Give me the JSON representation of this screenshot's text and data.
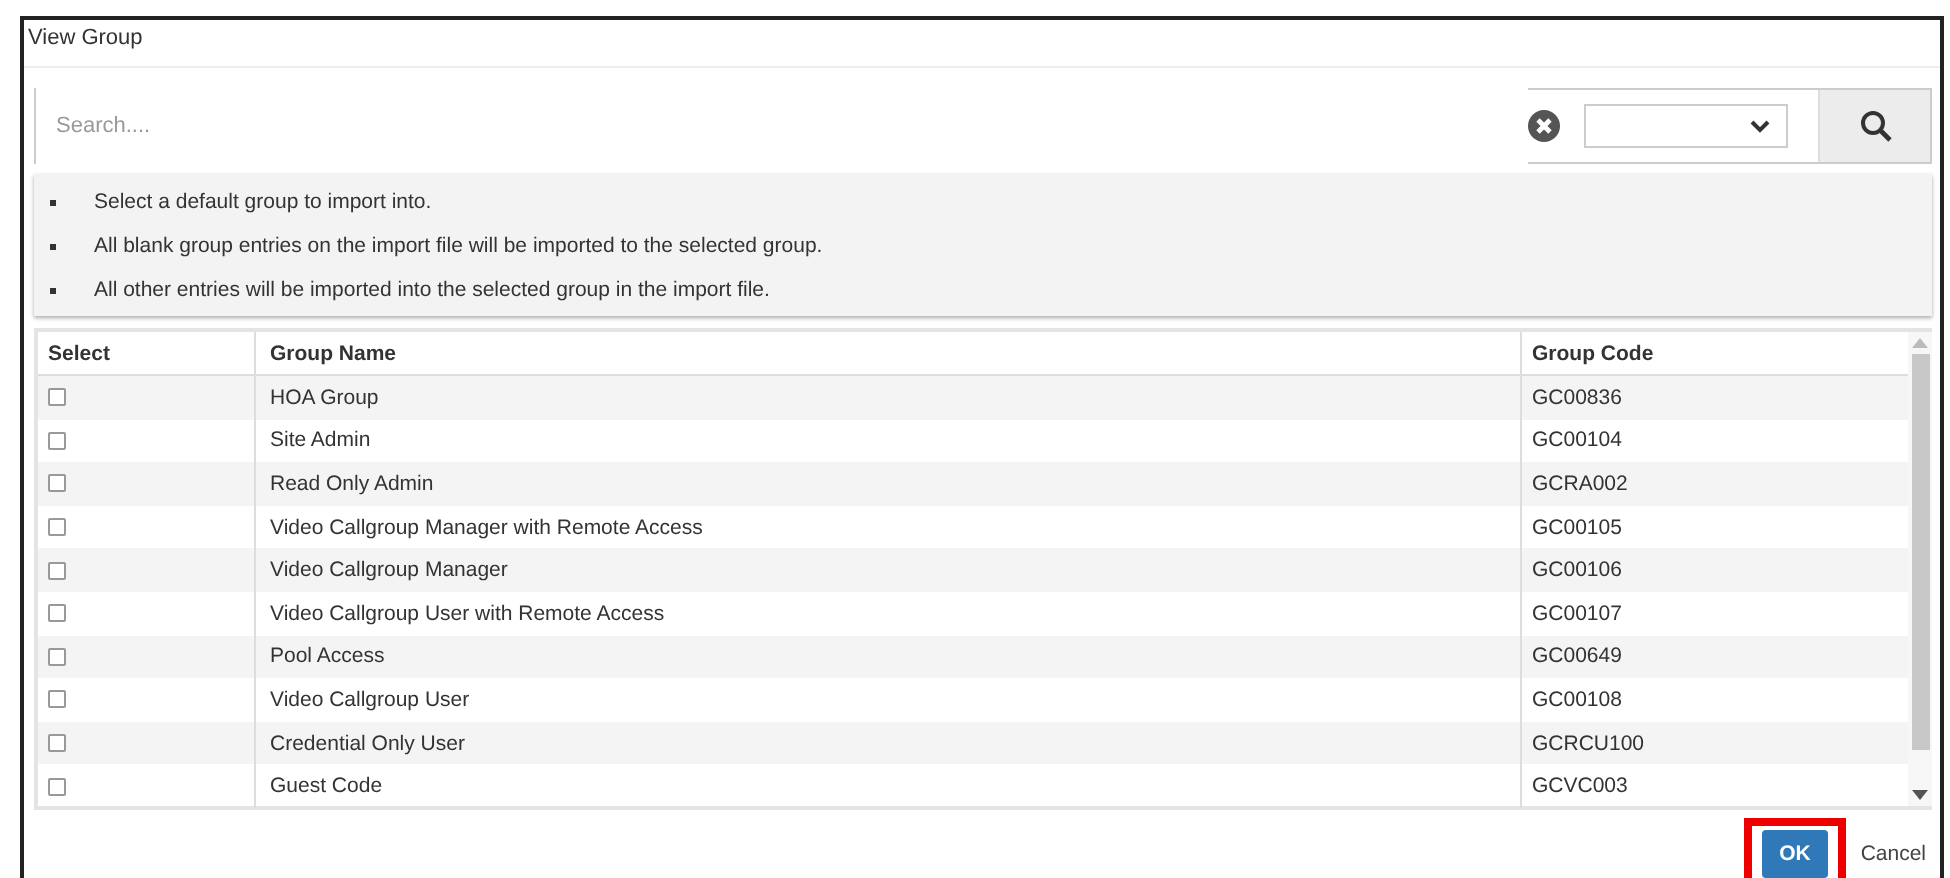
{
  "window": {
    "title": "View Group"
  },
  "search": {
    "placeholder": "Search...."
  },
  "notes": [
    "Select a default group to import into.",
    "All blank group entries on the import file will be imported to the selected group.",
    "All other entries will be imported into the selected group in the import file."
  ],
  "table": {
    "columns": [
      "Select",
      "Group Name",
      "Group Code"
    ],
    "rows": [
      {
        "checked": false,
        "name": "HOA Group",
        "code": "GC00836"
      },
      {
        "checked": false,
        "name": "Site Admin",
        "code": "GC00104"
      },
      {
        "checked": false,
        "name": "Read Only Admin",
        "code": "GCRA002"
      },
      {
        "checked": false,
        "name": "Video Callgroup Manager with Remote Access",
        "code": "GC00105"
      },
      {
        "checked": false,
        "name": "Video Callgroup Manager",
        "code": "GC00106"
      },
      {
        "checked": false,
        "name": "Video Callgroup User with Remote Access",
        "code": "GC00107"
      },
      {
        "checked": false,
        "name": "Pool Access",
        "code": "GC00649"
      },
      {
        "checked": false,
        "name": "Video Callgroup User",
        "code": "GC00108"
      },
      {
        "checked": false,
        "name": "Credential Only User",
        "code": "GCRCU100"
      },
      {
        "checked": false,
        "name": "Guest Code",
        "code": "GCVC003"
      }
    ]
  },
  "buttons": [
    {
      "label": "OK",
      "kind": "primary",
      "highlighted": true
    },
    {
      "label": "Cancel",
      "kind": "plain",
      "highlighted": false
    }
  ]
}
